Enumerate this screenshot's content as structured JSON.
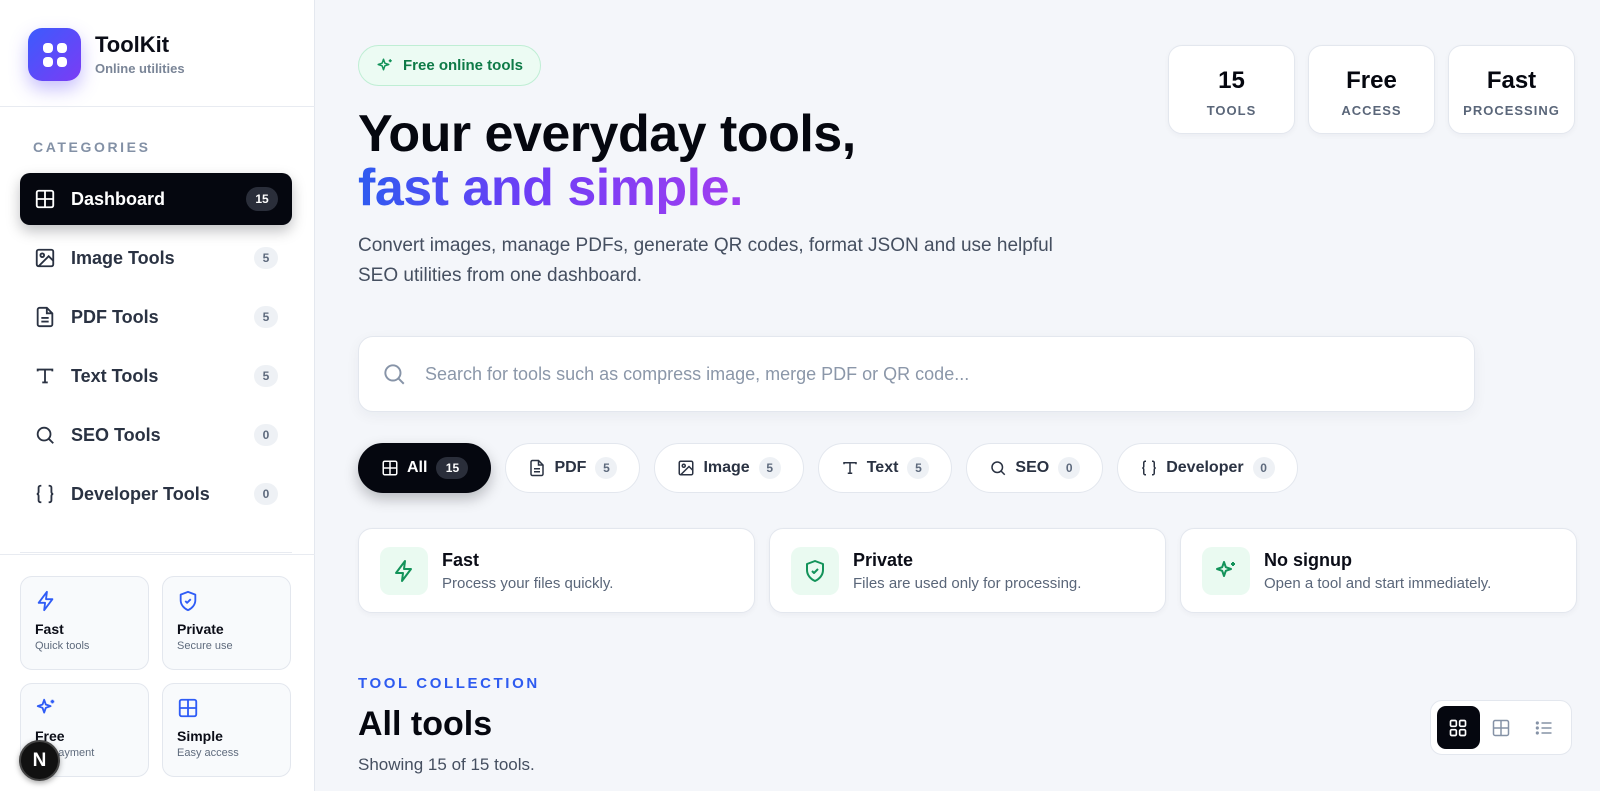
{
  "brand": {
    "title": "ToolKit",
    "subtitle": "Online utilities"
  },
  "sidebar": {
    "heading": "CATEGORIES",
    "items": [
      {
        "label": "Dashboard",
        "count": "15",
        "icon": "grid-icon",
        "active": true
      },
      {
        "label": "Image Tools",
        "count": "5",
        "icon": "image-icon"
      },
      {
        "label": "PDF Tools",
        "count": "5",
        "icon": "file-icon"
      },
      {
        "label": "Text Tools",
        "count": "5",
        "icon": "type-icon"
      },
      {
        "label": "SEO Tools",
        "count": "0",
        "icon": "search-icon"
      },
      {
        "label": "Developer Tools",
        "count": "0",
        "icon": "braces-icon"
      }
    ],
    "features": [
      {
        "title": "Fast",
        "subtitle": "Quick tools",
        "icon": "bolt-icon"
      },
      {
        "title": "Private",
        "subtitle": "Secure use",
        "icon": "shield-icon"
      },
      {
        "title": "Free",
        "subtitle": "No payment",
        "icon": "sparkle-icon"
      },
      {
        "title": "Simple",
        "subtitle": "Easy access",
        "icon": "grid-icon"
      }
    ],
    "dev_badge": "N"
  },
  "hero": {
    "pill": "Free online tools",
    "line1": "Your everyday tools,",
    "line2": "fast and simple.",
    "description": "Convert images, manage PDFs, generate QR codes, format JSON and use helpful SEO utilities from one dashboard."
  },
  "stats": [
    {
      "value": "15",
      "label": "TOOLS"
    },
    {
      "value": "Free",
      "label": "ACCESS"
    },
    {
      "value": "Fast",
      "label": "PROCESSING"
    }
  ],
  "search": {
    "placeholder": "Search for tools such as compress image, merge PDF or QR code...",
    "value": ""
  },
  "filters": [
    {
      "label": "All",
      "count": "15",
      "icon": "grid-icon",
      "active": true
    },
    {
      "label": "PDF",
      "count": "5",
      "icon": "file-icon"
    },
    {
      "label": "Image",
      "count": "5",
      "icon": "image-icon"
    },
    {
      "label": "Text",
      "count": "5",
      "icon": "type-icon"
    },
    {
      "label": "SEO",
      "count": "0",
      "icon": "search-icon"
    },
    {
      "label": "Developer",
      "count": "0",
      "icon": "braces-icon"
    }
  ],
  "benefits": [
    {
      "title": "Fast",
      "subtitle": "Process your files quickly.",
      "icon": "bolt-icon"
    },
    {
      "title": "Private",
      "subtitle": "Files are used only for processing.",
      "icon": "shield-icon"
    },
    {
      "title": "No signup",
      "subtitle": "Open a tool and start immediately.",
      "icon": "sparkle-icon"
    }
  ],
  "collection": {
    "tag": "TOOL COLLECTION",
    "title": "All tools",
    "count_text": "Showing 15 of 15 tools."
  },
  "view_toggle": [
    "grid-view",
    "table-view",
    "list-view"
  ],
  "colors": {
    "accent": "#2e5bf0",
    "purple": "#7b3cf5",
    "dark": "#05070f",
    "green": "#13935a"
  }
}
